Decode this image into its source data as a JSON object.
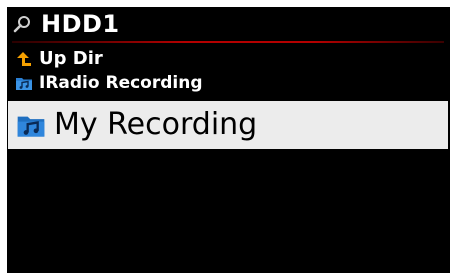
{
  "header": {
    "title": "HDD1",
    "icon": "search-icon"
  },
  "list": {
    "items": [
      {
        "label": "Up Dir",
        "icon": "up-dir-arrow-icon"
      },
      {
        "label": "IRadio Recording",
        "icon": "music-folder-icon"
      },
      {
        "label": "My Recording",
        "icon": "music-folder-icon",
        "selected": true
      }
    ]
  },
  "colors": {
    "background": "#000000",
    "text": "#ffffff",
    "selection": "#ececec",
    "selection_text": "#000000",
    "accent": "#b40000",
    "up_arrow": "#f5a000",
    "folder_icon": "#2a7fd4"
  }
}
